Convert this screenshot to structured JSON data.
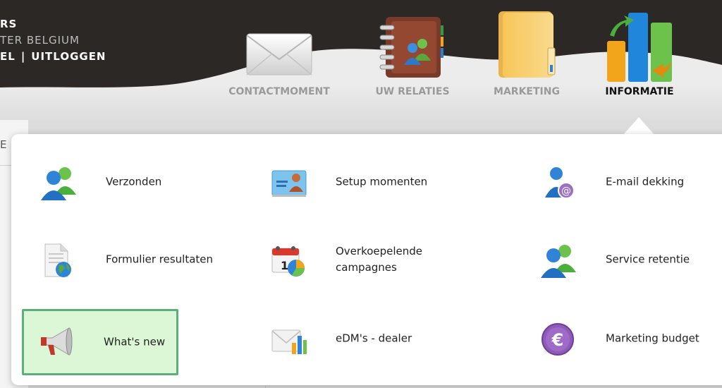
{
  "user": {
    "name": "RS",
    "org": "TER BELGIUM",
    "profile_link": "EL",
    "separator": "|",
    "logout_link": "UITLOGGEN"
  },
  "nav": {
    "items": [
      {
        "label": "CONTACTMOMENT",
        "icon": "envelope-icon",
        "active": false
      },
      {
        "label": "UW RELATIES",
        "icon": "address-book-icon",
        "active": false
      },
      {
        "label": "MARKETING",
        "icon": "folder-icon",
        "active": false
      },
      {
        "label": "INFORMATIE",
        "icon": "bar-chart-icon",
        "active": true
      }
    ]
  },
  "page": {
    "strip_letter": "E"
  },
  "menu": {
    "items": [
      {
        "label": "Verzonden",
        "icon": "people-icon"
      },
      {
        "label": "Setup momenten",
        "icon": "contact-card-icon"
      },
      {
        "label": "E-mail dekking",
        "icon": "person-email-icon"
      },
      {
        "label": "Formulier resultaten",
        "icon": "document-globe-icon"
      },
      {
        "label": "Overkoepelende campagnes",
        "icon": "calendar-chart-icon"
      },
      {
        "label": "Service retentie",
        "icon": "people-icon"
      },
      {
        "label": "What's new",
        "icon": "megaphone-icon",
        "highlighted": true
      },
      {
        "label": "eDM's - dealer",
        "icon": "envelope-chart-icon"
      },
      {
        "label": "Marketing budget",
        "icon": "euro-icon"
      }
    ]
  },
  "colors": {
    "header_dark": "#2b2826",
    "highlight_bg": "#dcf7d6",
    "highlight_border": "#5cae7c",
    "nav_inactive": "#9a9a9a",
    "nav_active": "#111111"
  }
}
